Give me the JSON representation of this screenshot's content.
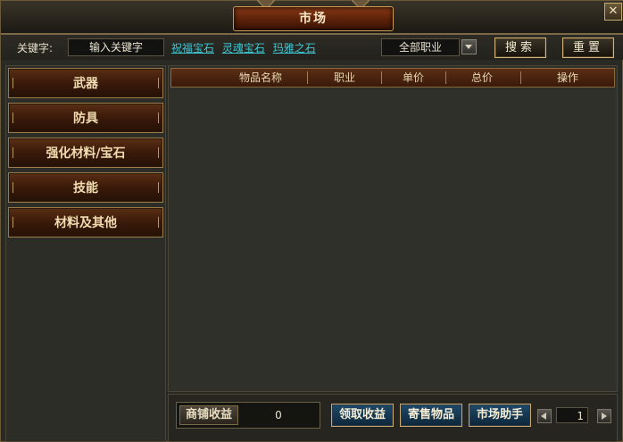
{
  "window": {
    "title": "市场"
  },
  "search": {
    "keyword_label": "关键字:",
    "keyword_placeholder": "输入关键字",
    "quick_links": [
      "祝福宝石",
      "灵魂宝石",
      "玛雅之石"
    ],
    "class_select": "全部职业",
    "search_label": "搜索",
    "reset_label": "重置"
  },
  "sidebar": {
    "items": [
      {
        "label": "武器"
      },
      {
        "label": "防具"
      },
      {
        "label": "强化材料/宝石"
      },
      {
        "label": "技能"
      },
      {
        "label": "材料及其他"
      }
    ]
  },
  "table": {
    "columns": [
      "物品名称",
      "职业",
      "单价",
      "总价",
      "操作"
    ],
    "rows": []
  },
  "footer": {
    "earnings_label": "商铺收益",
    "earnings_value": "0",
    "collect_label": "领取收益",
    "consign_label": "寄售物品",
    "assistant_label": "市场助手",
    "page": "1"
  },
  "colors": {
    "link": "#3ec6d2",
    "accent_gold": "#c7a872",
    "blue_button": "#1e4a6a"
  }
}
